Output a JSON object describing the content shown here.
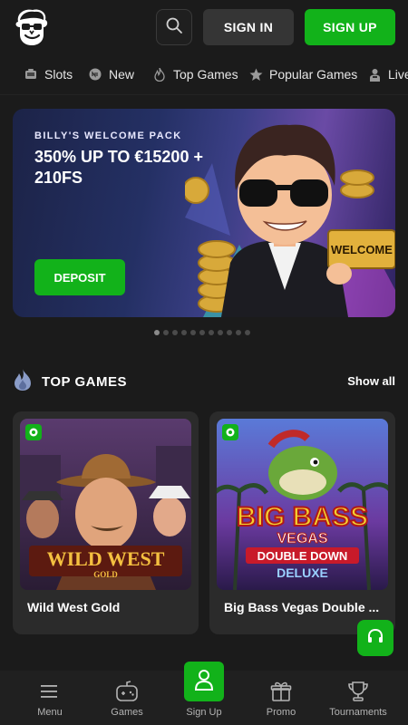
{
  "header": {
    "logo_icon": "billy-mascot-logo-icon",
    "search_icon": "search-icon",
    "sign_in_label": "SIGN IN",
    "sign_up_label": "SIGN UP"
  },
  "category_nav": [
    {
      "label": "Slots",
      "icon": "slot-machine-icon"
    },
    {
      "label": "New",
      "icon": "new-badge-icon"
    },
    {
      "label": "Top Games",
      "icon": "flame-icon"
    },
    {
      "label": "Popular Games",
      "icon": "star-icon"
    },
    {
      "label": "Live",
      "icon": "dealer-icon"
    }
  ],
  "banner": {
    "kicker": "BILLY'S WELCOME PACK",
    "title": "350% UP TO €15200 + 210FS",
    "button_label": "DEPOSIT",
    "sign_text": "WELCOME",
    "slide_count": 11,
    "active_slide": 1
  },
  "top_games": {
    "title": "TOP GAMES",
    "show_all_label": "Show all",
    "games": [
      {
        "name": "Wild West Gold",
        "art_title": "WILD WEST",
        "art_subtitle": "GOLD"
      },
      {
        "name": "Big Bass Vegas Double ...",
        "art_title": "BIG BASS",
        "art_subtitle": "VEGAS",
        "art_line3": "DOUBLE DOWN",
        "art_line4": "DELUXE"
      }
    ]
  },
  "support_icon": "headset-icon",
  "bottom_nav": [
    {
      "label": "Menu",
      "icon": "hamburger-menu-icon"
    },
    {
      "label": "Games",
      "icon": "gamepad-icon"
    },
    {
      "label": "Sign Up",
      "icon": "user-icon"
    },
    {
      "label": "Promo",
      "icon": "gift-icon"
    },
    {
      "label": "Tournaments",
      "icon": "trophy-icon"
    }
  ],
  "colors": {
    "accent_green": "#12b21a",
    "background": "#1b1b1b",
    "card": "#2b2b2b"
  }
}
